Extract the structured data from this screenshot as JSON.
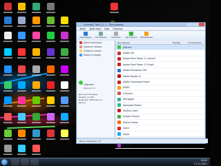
{
  "window": {
    "title": "Uninstall Tool 3.2.1 - Программы",
    "menu": [
      "Файл",
      "Действия",
      "Вид",
      "Помощь"
    ],
    "toolbar": [
      {
        "label": "Программы",
        "icon": "programs-icon"
      },
      {
        "label": "Системные",
        "icon": "system-icon"
      },
      {
        "label": "Скрытые",
        "icon": "hidden-icon"
      },
      {
        "label": "Автозапуск",
        "icon": "autorun-icon"
      },
      {
        "label": "Обновление",
        "icon": "update-icon"
      }
    ],
    "left_actions": [
      "Деинсталляция",
      "Удалить запись",
      "Открыть папку",
      "Поиск в Google"
    ],
    "program_name": "uTorrent",
    "program_version": "Версия 3.2",
    "details": [
      "Дата инсталляции",
      "Размер: 2.2 Mb",
      "Издатель: BitTorrent Inc",
      "Реестр"
    ],
    "columns": [
      "Программа",
      "Размер",
      "Установлено"
    ],
    "rows": [
      {
        "name": "µTorrent",
        "size": "",
        "date": ""
      },
      {
        "name": "Adobe AIR",
        "size": "",
        "date": ""
      },
      {
        "name": "Adobe Flash Player 11 ActiveX",
        "size": "",
        "date": ""
      },
      {
        "name": "Adobe Flash Player 11 Plugin",
        "size": "",
        "date": ""
      },
      {
        "name": "Adobe Photoshop CS6",
        "size": "",
        "date": ""
      },
      {
        "name": "Adobe Reader XI",
        "size": "",
        "date": ""
      },
      {
        "name": "Adobe Shockwave Player",
        "size": "",
        "date": ""
      },
      {
        "name": "AIMP3",
        "size": "",
        "date": ""
      },
      {
        "name": "CCleaner",
        "size": "",
        "date": ""
      },
      {
        "name": "Defraggler",
        "size": "",
        "date": ""
      },
      {
        "name": "Download Master",
        "size": "",
        "date": ""
      },
      {
        "name": "FileZilla Client",
        "size": "",
        "date": ""
      },
      {
        "name": "Google Chrome",
        "size": "",
        "date": ""
      },
      {
        "name": "Mozilla Firefox",
        "size": "",
        "date": ""
      },
      {
        "name": "Opera",
        "size": "",
        "date": ""
      },
      {
        "name": "Skype",
        "size": "",
        "date": ""
      },
      {
        "name": "VLC media player",
        "size": "",
        "date": ""
      },
      {
        "name": "WinRAR",
        "size": "",
        "date": ""
      }
    ],
    "status": "Всего программ: 37"
  },
  "taskbar": {
    "time": "16:03",
    "date": "21.11.2012"
  },
  "colors": {
    "accent": "#1d5ea8",
    "selection": "#cfe3fb"
  }
}
